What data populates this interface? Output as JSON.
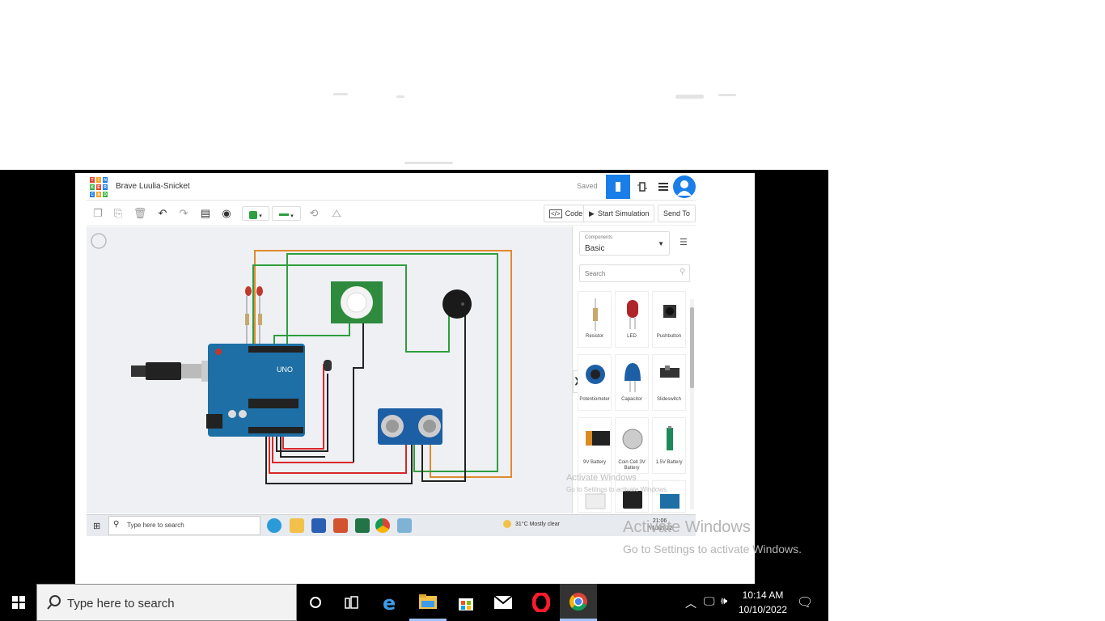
{
  "app": {
    "title": "Brave Luulia-Snicket",
    "status": "Saved",
    "buttons": {
      "code": "Code",
      "start_simulation": "Start Simulation",
      "send_to": "Send To"
    },
    "panel": {
      "select_label": "Components",
      "select_value": "Basic",
      "search_placeholder": "Search",
      "components": [
        {
          "label": "Resistor"
        },
        {
          "label": "LED"
        },
        {
          "label": "Pushbutton"
        },
        {
          "label": "Potentiometer"
        },
        {
          "label": "Capacitor"
        },
        {
          "label": "Slideswitch"
        },
        {
          "label": "9V Battery"
        },
        {
          "label": "Coin Cell 3V Battery"
        },
        {
          "label": "1.5V Battery"
        }
      ]
    },
    "board_label": "UNO"
  },
  "inner_taskbar": {
    "search_placeholder": "Type here to search",
    "weather": "31°C  Mostly clear",
    "time": "21:06",
    "date": "7/10/2022"
  },
  "watermark": {
    "small_title": "Activate Windows",
    "small_sub": "Go to Settings to activate Windows.",
    "large_title": "Activate Windows",
    "large_sub": "Go to Settings to activate Windows."
  },
  "taskbar": {
    "search_placeholder": "Type here to search",
    "time": "10:14 AM",
    "date": "10/10/2022"
  },
  "colors": {
    "tinkercad_blue": "#1a7ee8",
    "arduino_teal": "#1d6fa5",
    "wire_green": "#2e9e3e",
    "wire_orange": "#e08a2e",
    "wire_red": "#d9262a",
    "wire_black": "#222222"
  }
}
